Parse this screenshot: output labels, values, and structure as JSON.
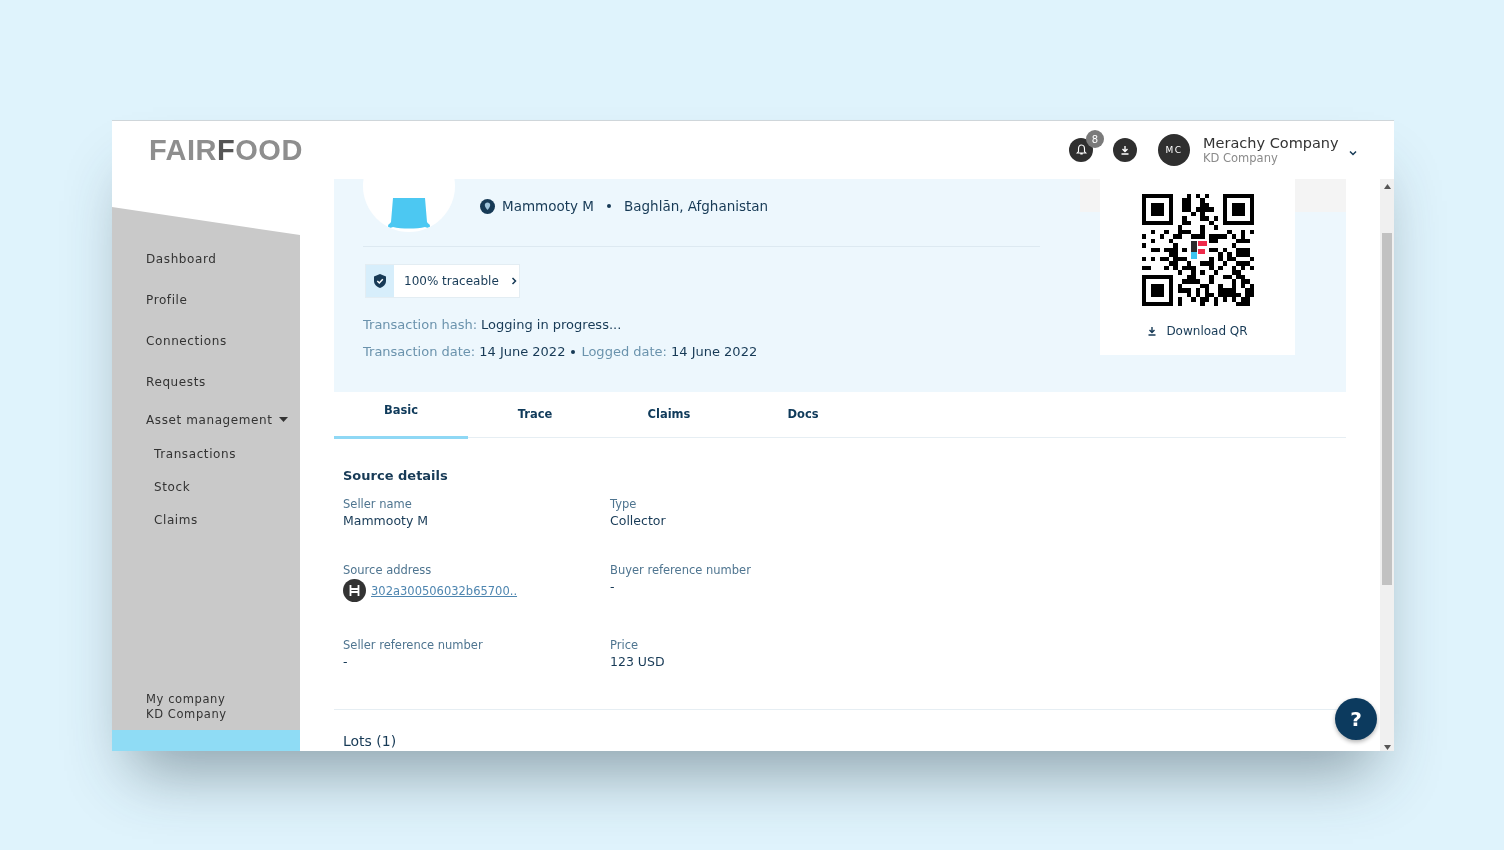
{
  "logo": {
    "text": "FAIR**F**OOD"
  },
  "header": {
    "notifications": {
      "count": "8"
    },
    "user": {
      "initials": "MC",
      "name": "Merachy Company",
      "company": "KD Company"
    }
  },
  "sidebar": {
    "items": [
      {
        "label": "Dashboard"
      },
      {
        "label": "Profile"
      },
      {
        "label": "Connections"
      },
      {
        "label": "Requests"
      },
      {
        "label": "Asset management",
        "expanded": true,
        "children": [
          {
            "label": "Transactions"
          },
          {
            "label": "Stock"
          },
          {
            "label": "Claims"
          }
        ]
      }
    ],
    "footer": {
      "label": "My company",
      "value": "KD Company"
    }
  },
  "hero": {
    "actor": "Mammooty M",
    "location": "Baghlān, Afghanistan",
    "traceability": {
      "label": "100% traceable"
    },
    "hash": {
      "label": "Transaction hash:",
      "value": "Logging in progress..."
    },
    "dates": [
      {
        "label": "Transaction date:",
        "value": "14 June 2022"
      },
      {
        "label": "Logged date:",
        "value": "14 June 2022"
      }
    ]
  },
  "qr": {
    "download_label": "Download QR"
  },
  "tabs": [
    {
      "label": "Basic",
      "selected": true
    },
    {
      "label": "Trace",
      "selected": false
    },
    {
      "label": "Claims",
      "selected": false
    },
    {
      "label": "Docs",
      "selected": false
    }
  ],
  "section": {
    "title": "Source details",
    "fields": [
      {
        "label": "Seller name",
        "value": "Mammooty M",
        "kind": "text"
      },
      {
        "label": "Type",
        "value": "Collector",
        "kind": "text"
      },
      {
        "label": "Source address",
        "value": "302a300506032b65700..",
        "kind": "link"
      },
      {
        "label": "Buyer reference number",
        "value": "-",
        "kind": "text"
      },
      {
        "label": "Seller reference number",
        "value": "-",
        "kind": "text"
      },
      {
        "label": "Price",
        "value": "123 USD",
        "kind": "text"
      }
    ]
  },
  "lots": {
    "title": "Lots (1)"
  },
  "help": {
    "label": "?"
  }
}
